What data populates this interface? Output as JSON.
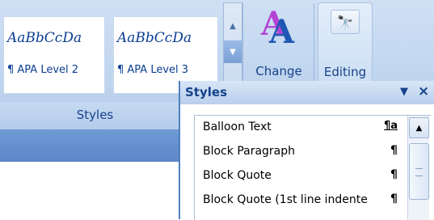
{
  "ribbon": {
    "quick_styles": [
      {
        "preview": "AaBbCcDa",
        "name": "¶ APA Level 2"
      },
      {
        "preview": "AaBbCcDa",
        "name": "¶ APA Level 3"
      }
    ],
    "gallery_scroll": {
      "up_icon": "▲",
      "more_icon": "▼"
    },
    "group_label": "Styles",
    "change_styles_label": "Change",
    "editing": {
      "label": "Editing",
      "icon": "find-icon",
      "glyph": "🔭"
    }
  },
  "styles_pane": {
    "title": "Styles",
    "menu_icon": "▼",
    "close_icon": "×",
    "items": [
      {
        "name": "Balloon Text",
        "mark": "¶a"
      },
      {
        "name": "Block Paragraph",
        "mark": "¶"
      },
      {
        "name": "Block Quote",
        "mark": "¶"
      },
      {
        "name": "Block Quote (1st line indente",
        "mark": "¶"
      }
    ],
    "scroll_up_icon": "▲"
  }
}
